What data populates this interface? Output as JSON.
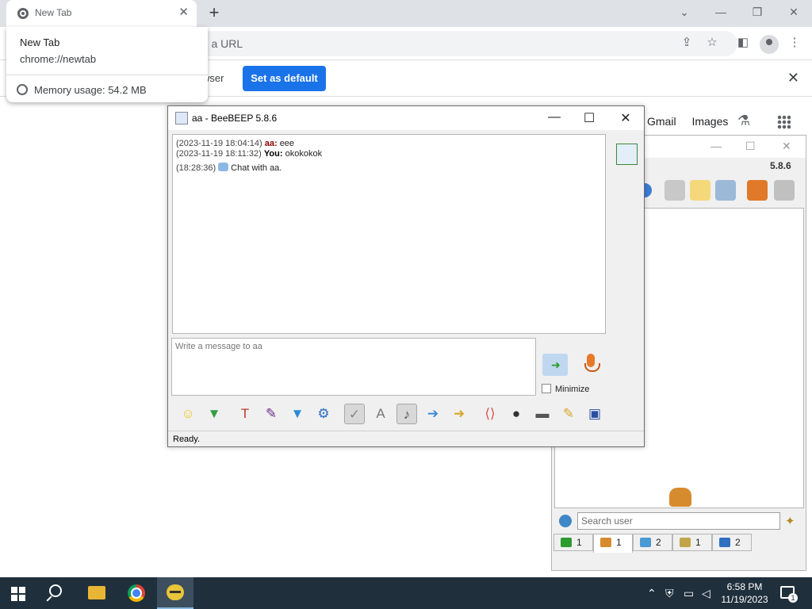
{
  "browser": {
    "tab_title": "New Tab",
    "omnibox_placeholder": "Search Google or type a URL",
    "omnibox_visible_text": "ype a URL",
    "infobar_text": "wser",
    "infobar_button": "Set as default",
    "ntp_links": [
      "Gmail",
      "Images"
    ],
    "tab_hover": {
      "title": "New Tab",
      "url": "chrome://newtab",
      "memory": "Memory usage: 54.2 MB"
    }
  },
  "beebeep_main": {
    "version": "5.8.6",
    "search_placeholder": "Search user",
    "tabs": [
      {
        "count": "1",
        "color": "#2e9b2e"
      },
      {
        "count": "1",
        "color": "#d78b2f"
      },
      {
        "count": "2",
        "color": "#4a9ad6"
      },
      {
        "count": "1",
        "color": "#c2a548"
      },
      {
        "count": "2",
        "color": "#2f6fbf"
      }
    ]
  },
  "chat": {
    "title": "aa - BeeBEEP 5.8.6",
    "messages": [
      {
        "ts": "(2023-11-19 18:04:14)",
        "who": "aa:",
        "text": "eee"
      },
      {
        "ts": "(2023-11-19 18:11:32)",
        "who": "You:",
        "text": "okokokok"
      }
    ],
    "system": {
      "ts": "(18:28:36)",
      "text": "Chat with aa."
    },
    "compose_placeholder": "Write a message to aa",
    "minimize_label": "Minimize",
    "status": "Ready.",
    "toolbar_icons": [
      {
        "name": "emoticon-icon",
        "glyph": "☺",
        "color": "#f5c518"
      },
      {
        "name": "green-arrow-icon",
        "glyph": "▼",
        "color": "#2ea043"
      },
      {
        "name": "font-icon",
        "glyph": "T",
        "color": "#c0392b"
      },
      {
        "name": "color-icon",
        "glyph": "✎",
        "color": "#6a2a8a"
      },
      {
        "name": "filter-icon",
        "glyph": "▼",
        "color": "#2a8ad6"
      },
      {
        "name": "settings-icon",
        "glyph": "⚙",
        "color": "#2a6fc2"
      },
      {
        "name": "spellcheck-icon",
        "glyph": "✓",
        "color": "#888888"
      },
      {
        "name": "dictionary-icon",
        "glyph": "A",
        "color": "#777777"
      },
      {
        "name": "music-icon",
        "glyph": "♪",
        "color": "#555555"
      },
      {
        "name": "send-file-icon",
        "glyph": "➔",
        "color": "#3a8ad6"
      },
      {
        "name": "send-folder-icon",
        "glyph": "➜",
        "color": "#d9a62a"
      },
      {
        "name": "code-icon",
        "glyph": "⟨⟩",
        "color": "#d9534f"
      },
      {
        "name": "screenshot-icon",
        "glyph": "●",
        "color": "#333333"
      },
      {
        "name": "clear-icon",
        "glyph": "▬",
        "color": "#555555"
      },
      {
        "name": "edit-icon",
        "glyph": "✎",
        "color": "#d9a62a"
      },
      {
        "name": "save-icon",
        "glyph": "▣",
        "color": "#2a4fa2"
      }
    ]
  },
  "taskbar": {
    "time": "6:58 PM",
    "date": "11/19/2023",
    "notification_count": "1"
  }
}
